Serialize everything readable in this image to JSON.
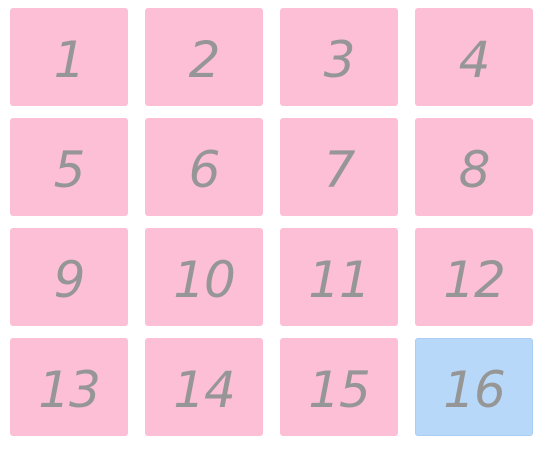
{
  "tiles": [
    {
      "label": "1",
      "selected": false
    },
    {
      "label": "2",
      "selected": false
    },
    {
      "label": "3",
      "selected": false
    },
    {
      "label": "4",
      "selected": false
    },
    {
      "label": "5",
      "selected": false
    },
    {
      "label": "6",
      "selected": false
    },
    {
      "label": "7",
      "selected": false
    },
    {
      "label": "8",
      "selected": false
    },
    {
      "label": "9",
      "selected": false
    },
    {
      "label": "10",
      "selected": false
    },
    {
      "label": "11",
      "selected": false
    },
    {
      "label": "12",
      "selected": false
    },
    {
      "label": "13",
      "selected": false
    },
    {
      "label": "14",
      "selected": false
    },
    {
      "label": "15",
      "selected": false
    },
    {
      "label": "16",
      "selected": true
    }
  ],
  "colors": {
    "tile_bg": "#fcbfd6",
    "selected_bg": "#b8d8f9",
    "text": "#969696"
  }
}
